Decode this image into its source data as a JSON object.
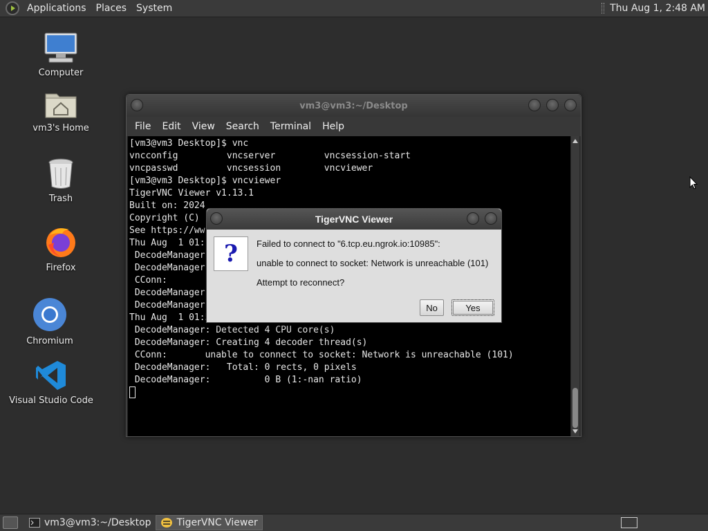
{
  "top_panel": {
    "menus": [
      "Applications",
      "Places",
      "System"
    ],
    "clock": "Thu Aug  1,  2:48 AM"
  },
  "desktop_icons": [
    {
      "label": "Computer",
      "icon": "computer-icon"
    },
    {
      "label": "vm3's Home",
      "icon": "home-folder-icon"
    },
    {
      "label": "Trash",
      "icon": "trash-icon"
    },
    {
      "label": "Firefox",
      "icon": "firefox-icon"
    },
    {
      "label": "Chromium",
      "icon": "chromium-icon"
    },
    {
      "label": "Visual Studio Code",
      "icon": "vscode-icon"
    }
  ],
  "terminal": {
    "title": "vm3@vm3:~/Desktop",
    "menu": [
      "File",
      "Edit",
      "View",
      "Search",
      "Terminal",
      "Help"
    ],
    "lines": [
      "[vm3@vm3 Desktop]$ vnc",
      "vncconfig         vncserver         vncsession-start",
      "vncpasswd         vncsession        vncviewer",
      "[vm3@vm3 Desktop]$ vncviewer",
      "",
      "TigerVNC Viewer v1.13.1",
      "Built on: 2024",
      "Copyright (C)                                                 t)",
      "See https://ww",
      "",
      "Thu Aug  1 01:",
      " DecodeManager",
      " DecodeManager",
      " CConn:                                                       101)",
      " DecodeManager",
      " DecodeManager:          0 B (1:-nan ratio)",
      "",
      "Thu Aug  1 01:55:09 2024",
      " DecodeManager: Detected 4 CPU core(s)",
      " DecodeManager: Creating 4 decoder thread(s)",
      " CConn:       unable to connect to socket: Network is unreachable (101)",
      " DecodeManager:   Total: 0 rects, 0 pixels",
      " DecodeManager:          0 B (1:-nan ratio)"
    ]
  },
  "dialog": {
    "title": "TigerVNC Viewer",
    "icon": "question-icon",
    "line1": "Failed to connect to \"6.tcp.eu.ngrok.io:10985\":",
    "line2": "unable to connect to socket: Network is unreachable (101)",
    "line3": "Attempt to reconnect?",
    "no_label": "No",
    "yes_label": "Yes"
  },
  "taskbar": {
    "items": [
      {
        "label": "vm3@vm3:~/Desktop",
        "icon": "terminal-icon"
      },
      {
        "label": "TigerVNC Viewer",
        "icon": "tigervnc-icon"
      }
    ]
  }
}
